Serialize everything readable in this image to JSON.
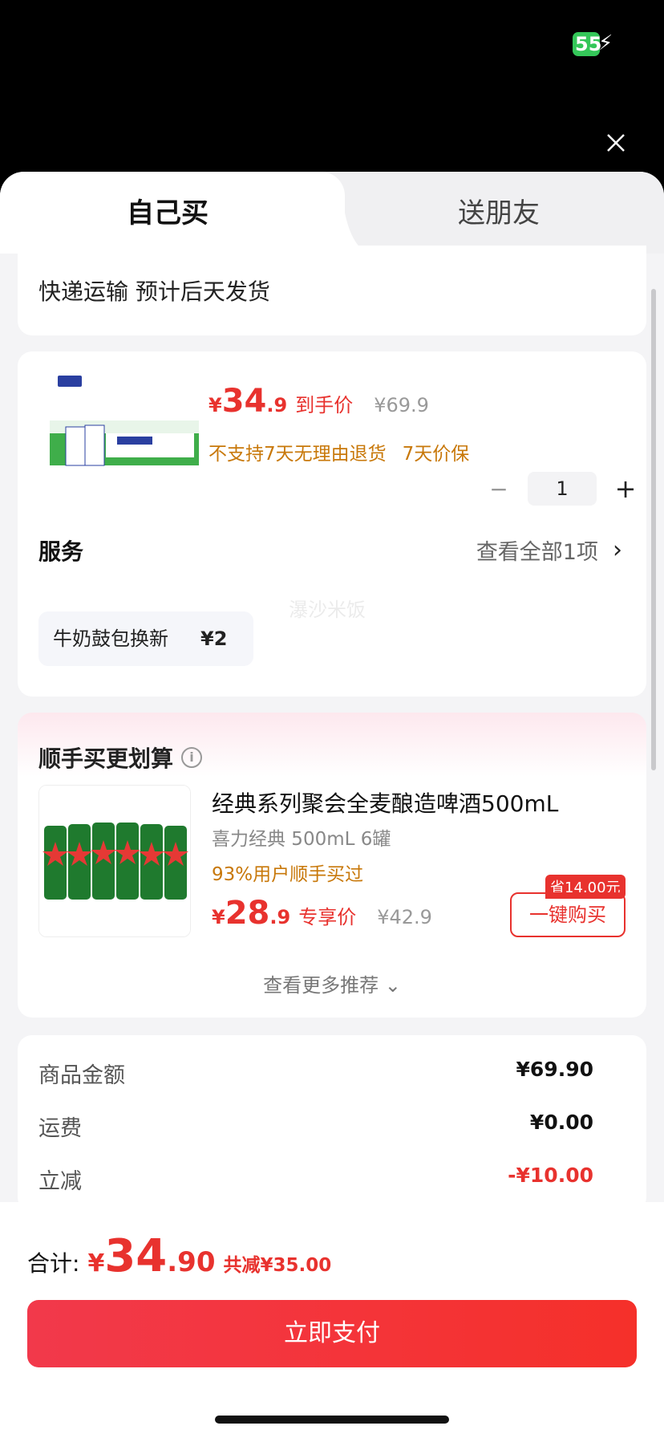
{
  "status": {
    "battery": "55"
  },
  "tabs": {
    "self": "自己买",
    "friend": "送朋友"
  },
  "shipping": {
    "text": "快递运输 预计后天发货"
  },
  "product": {
    "currency": "¥",
    "price_int": "34",
    "price_dec": ".9",
    "price_tag": "到手价",
    "original_price": "¥69.9",
    "notice_1": "不支持7天无理由退货",
    "notice_2": "7天价保",
    "quantity": "1",
    "minus": "−",
    "plus": "+"
  },
  "service": {
    "title": "服务",
    "view_all": "查看全部1项",
    "chip_label": "牛奶鼓包换新",
    "chip_price": "¥2"
  },
  "watermark": "瀑沙米饭",
  "recommend": {
    "title": "顺手买更划算",
    "name": "经典系列聚会全麦酿造啤酒500mL",
    "spec": "喜力经典 500mL 6罐",
    "rate": "93%用户顺手买过",
    "currency": "¥",
    "price_int": "28",
    "price_dec": ".9",
    "price_tag": "专享价",
    "original_price": "¥42.9",
    "save_badge": "省14.00元",
    "buy_label": "一键购买",
    "more": "查看更多推荐"
  },
  "summary": {
    "rows": [
      {
        "label": "商品金额",
        "value": "¥69.90"
      },
      {
        "label": "运费",
        "value": "¥0.00"
      },
      {
        "label": "立减",
        "value": "-¥10.00"
      }
    ]
  },
  "bottom": {
    "total_label": "合计:",
    "currency": "¥",
    "total_int": "34",
    "total_dec": ".90",
    "saved": "共减¥35.00",
    "pay_label": "立即支付"
  },
  "colors": {
    "accent": "#e8322e",
    "warning": "#c8780a"
  }
}
